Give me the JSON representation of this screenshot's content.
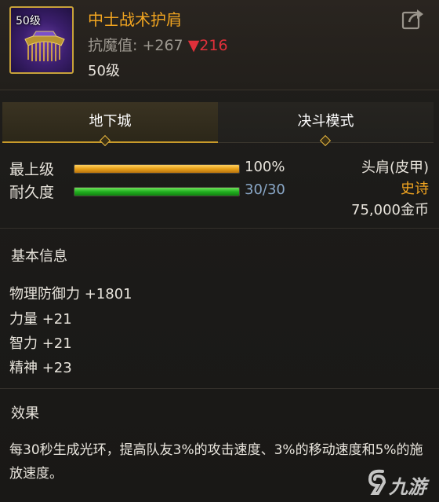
{
  "item": {
    "level_badge": "50级",
    "name": "中士战术护肩",
    "resistance_label": "抗魔值:",
    "resistance_value": "+267",
    "resistance_delta": "▼216",
    "level": "50级"
  },
  "tabs": [
    {
      "label": "地下城",
      "active": true
    },
    {
      "label": "决斗模式",
      "active": false
    }
  ],
  "bars": {
    "level": {
      "label": "最上级",
      "value": "100%",
      "fraction": 1.0
    },
    "durability": {
      "label": "耐久度",
      "value": "30/30",
      "fraction": 1.0
    }
  },
  "info": {
    "slot": "头肩(皮甲)",
    "rarity": "史诗",
    "price": "75,000金币"
  },
  "basic": {
    "title": "基本信息",
    "attributes": [
      "物理防御力 +1801",
      "力量 +21",
      "智力 +21",
      "精神 +23"
    ]
  },
  "effect": {
    "title": "效果",
    "text": "每30秒生成光环，提高队友3%的攻击速度、3%的移动速度和5%的施放速度。"
  },
  "watermark": {
    "text": "九游"
  },
  "colors": {
    "name": "#f2a520",
    "rarity": "#f2a520",
    "delta_down": "#e0303a",
    "level_bar": "#e8a018",
    "durability_bar": "#22b020"
  }
}
